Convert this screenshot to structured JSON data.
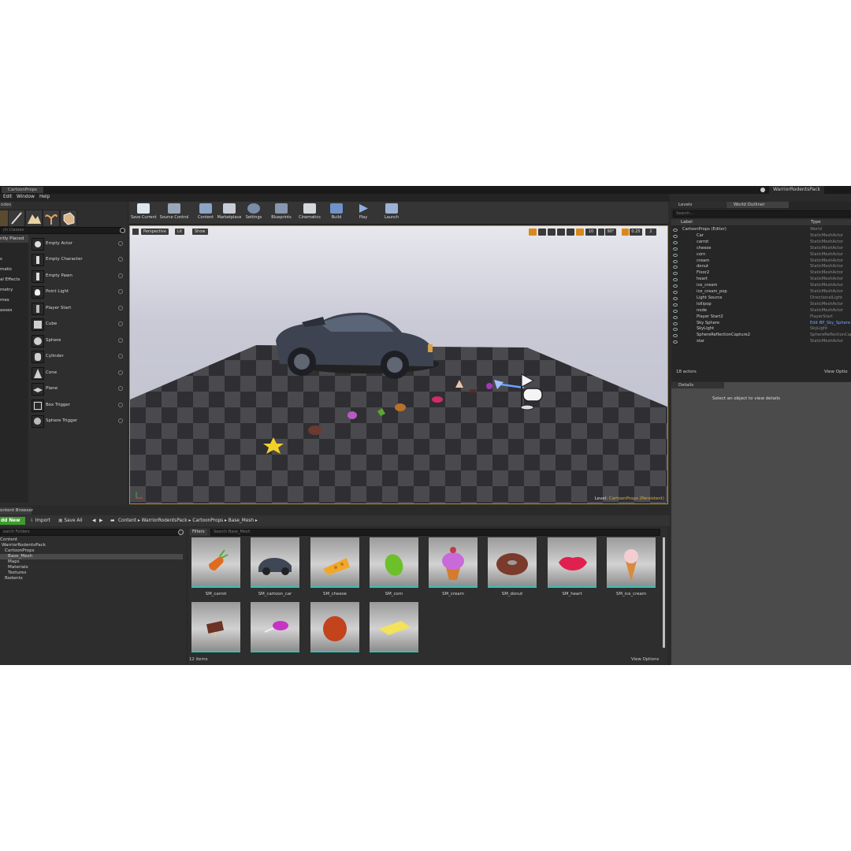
{
  "title_tab": "CartoonProps",
  "project_name": "WarriorRodentsPack",
  "menu": [
    "Edit",
    "Window",
    "Help"
  ],
  "modes": {
    "tab": "odes",
    "search_placeholder": "ch Classes",
    "categories": [
      "ntly Placed",
      "",
      "s",
      "matic",
      "al Effects",
      "metry",
      "mes",
      "asses"
    ],
    "items": [
      "Empty Actor",
      "Empty Character",
      "Empty Pawn",
      "Point Light",
      "Player Start",
      "Cube",
      "Sphere",
      "Cylinder",
      "Cone",
      "Plane",
      "Box Trigger",
      "Sphere Trigger"
    ]
  },
  "toolbar": [
    {
      "label": "Save Current",
      "icon": "save-icon"
    },
    {
      "label": "Source Control",
      "icon": "source-control-icon"
    },
    {
      "label": "Content",
      "icon": "content-icon"
    },
    {
      "label": "Marketplace",
      "icon": "marketplace-icon"
    },
    {
      "label": "Settings",
      "icon": "settings-icon"
    },
    {
      "label": "Blueprints",
      "icon": "blueprints-icon"
    },
    {
      "label": "Cinematics",
      "icon": "cinematics-icon"
    },
    {
      "label": "Build",
      "icon": "build-icon"
    },
    {
      "label": "Play",
      "icon": "play-icon"
    },
    {
      "label": "Launch",
      "icon": "launch-icon"
    }
  ],
  "viewport": {
    "perspective": "Perspective",
    "lit": "Lit",
    "show": "Show",
    "grid_snap": "10",
    "rot_snap": "90°",
    "scale_snap": "0.25",
    "cam_speed": "2",
    "level_label": "Level:",
    "level_name": "CartoonProps (Persistent)"
  },
  "outliner": {
    "tabs": [
      "Levels",
      "World Outliner"
    ],
    "search_placeholder": "Search...",
    "col_label": "Label",
    "col_type": "Type",
    "rows": [
      {
        "label": "CartoonProps (Editor)",
        "type": "World"
      },
      {
        "label": "Car",
        "type": "StaticMeshActor"
      },
      {
        "label": "carrot",
        "type": "StaticMeshActor"
      },
      {
        "label": "cheese",
        "type": "StaticMeshActor"
      },
      {
        "label": "corn",
        "type": "StaticMeshActor"
      },
      {
        "label": "cream",
        "type": "StaticMeshActor"
      },
      {
        "label": "donut",
        "type": "StaticMeshActor"
      },
      {
        "label": "Floor2",
        "type": "StaticMeshActor"
      },
      {
        "label": "heart",
        "type": "StaticMeshActor"
      },
      {
        "label": "ice_cream",
        "type": "StaticMeshActor"
      },
      {
        "label": "ice_cream_pop",
        "type": "StaticMeshActor"
      },
      {
        "label": "Light Source",
        "type": "DirectionalLight"
      },
      {
        "label": "lollipop",
        "type": "StaticMeshActor"
      },
      {
        "label": "node",
        "type": "StaticMeshActor"
      },
      {
        "label": "Player Start2",
        "type": "PlayerStart"
      },
      {
        "label": "Sky Sphere",
        "type": "Edit BP_Sky_Sphere"
      },
      {
        "label": "SkyLight",
        "type": "SkyLight"
      },
      {
        "label": "SphereReflectionCapture2",
        "type": "SphereReflectionCapt"
      },
      {
        "label": "star",
        "type": "StaticMeshActor"
      }
    ],
    "actor_count": "18 actors",
    "view_options": "View Optio"
  },
  "details": {
    "tab": "Details",
    "empty_msg": "Select an object to view details"
  },
  "content_browser": {
    "tab": "ontent Browser",
    "add_new": "dd New",
    "import": "Import",
    "save_all": "Save All",
    "path": [
      "Content",
      "WarriorRodentsPack",
      "CartoonProps",
      "Base_Mesh"
    ],
    "search_folders": "earch Folders",
    "filters": "Filters",
    "search_assets": "Search Base_Mesh",
    "folders": [
      {
        "name": "Content",
        "depth": 0
      },
      {
        "name": "WarriorRodentsPack",
        "depth": 1
      },
      {
        "name": "CartoonProps",
        "depth": 1
      },
      {
        "name": "Base_Mesh",
        "depth": 2,
        "selected": true
      },
      {
        "name": "Maps",
        "depth": 2
      },
      {
        "name": "Materials",
        "depth": 2
      },
      {
        "name": "Textures",
        "depth": 2
      },
      {
        "name": "Rodents",
        "depth": 1
      }
    ],
    "assets": [
      "SM_carrot",
      "SM_cartoon_car",
      "SM_cheese",
      "SM_corn",
      "SM_cream",
      "SM_donut",
      "SM_heart",
      "SM_ice_cream",
      "",
      "",
      "",
      ""
    ],
    "item_count": "12 items",
    "view_options": "View Options"
  },
  "colors": {
    "accent_teal": "#2ec4b6",
    "viewport_border": "#b59027",
    "add_new_green": "#3f9b2f"
  }
}
